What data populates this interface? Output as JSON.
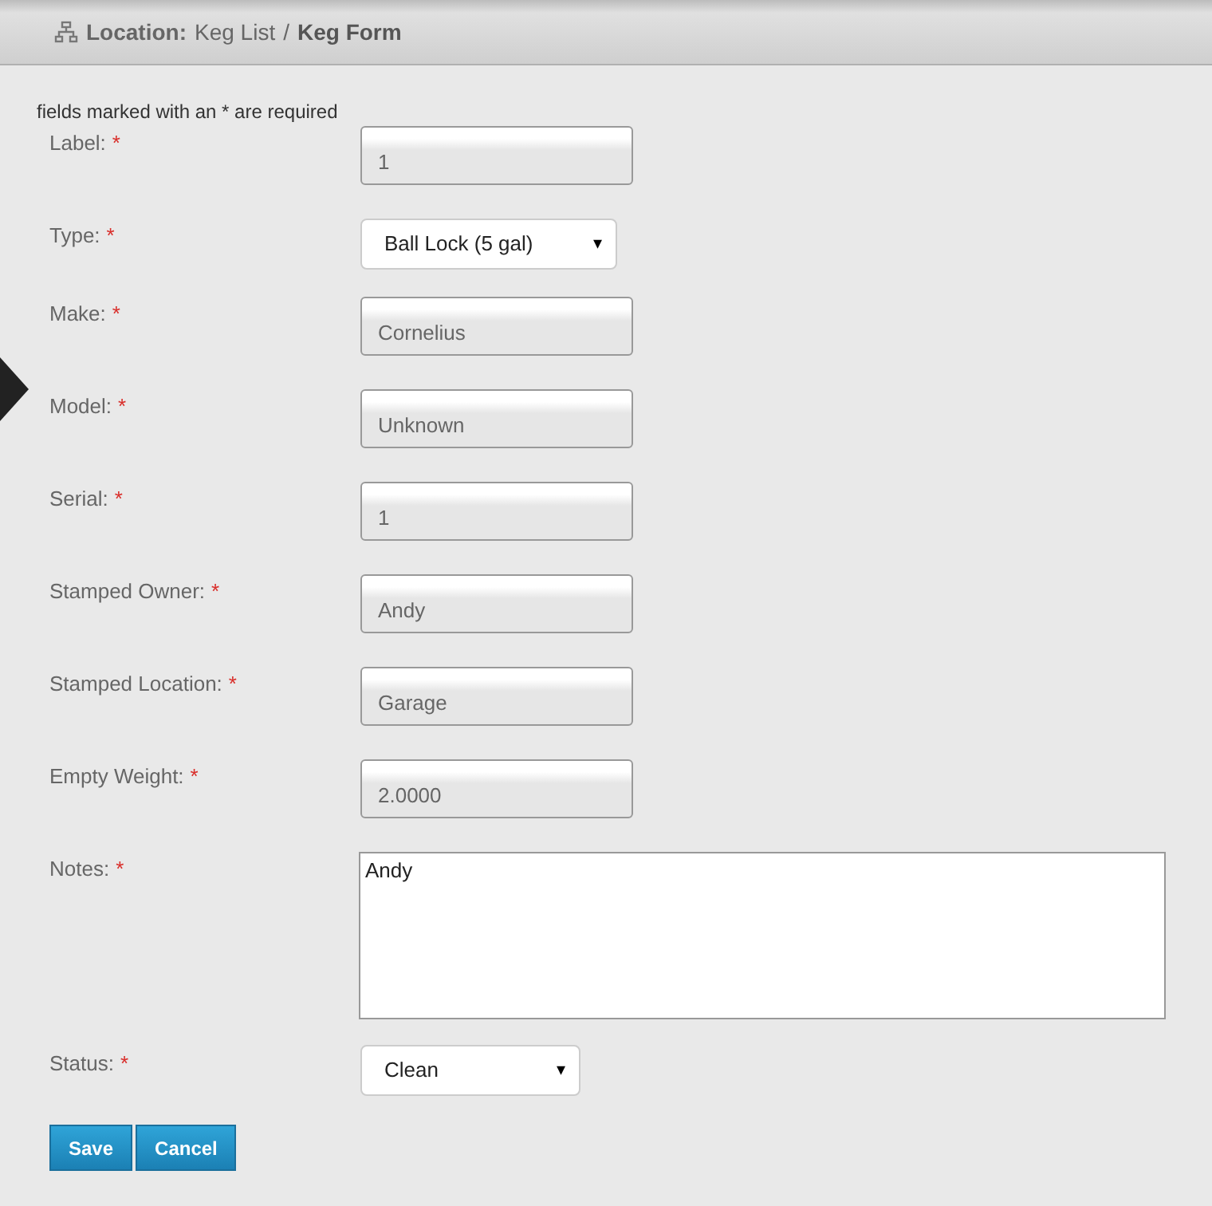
{
  "breadcrumb": {
    "prefix": "Location:",
    "link": "Keg List",
    "separator": "/",
    "current": "Keg Form"
  },
  "required_note": "fields marked with an * are required",
  "fields": [
    {
      "kind": "input",
      "label": "Label:",
      "required": true,
      "value": "1"
    },
    {
      "kind": "select",
      "label": "Type:",
      "required": true,
      "value": "Ball Lock (5 gal)"
    },
    {
      "kind": "input",
      "label": "Make:",
      "required": true,
      "value": "Cornelius"
    },
    {
      "kind": "input",
      "label": "Model:",
      "required": true,
      "value": "Unknown"
    },
    {
      "kind": "input",
      "label": "Serial:",
      "required": true,
      "value": "1"
    },
    {
      "kind": "input",
      "label": "Stamped Owner:",
      "required": true,
      "value": "Andy"
    },
    {
      "kind": "input",
      "label": "Stamped Location:",
      "required": true,
      "value": "Garage"
    },
    {
      "kind": "input",
      "label": "Empty Weight:",
      "required": true,
      "value": "2.0000"
    },
    {
      "kind": "textarea",
      "label": "Notes:",
      "required": true,
      "value": "Andy"
    },
    {
      "kind": "select_small",
      "label": "Status:",
      "required": true,
      "value": "Clean"
    }
  ],
  "required_mark": "*",
  "select_caret": "▾",
  "buttons": [
    "Save",
    "Cancel"
  ]
}
